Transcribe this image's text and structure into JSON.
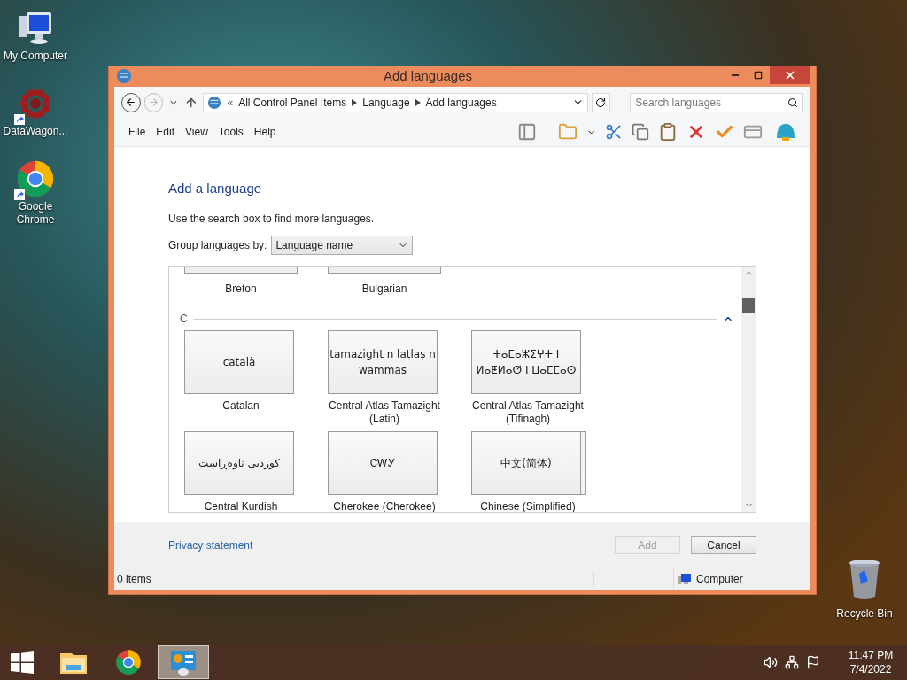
{
  "desktop_icons": [
    {
      "label": "My Computer",
      "kind": "computer",
      "shortcut": false
    },
    {
      "label": "DataWagon...",
      "kind": "flower",
      "shortcut": true
    },
    {
      "label": "Google Chrome",
      "kind": "chrome",
      "shortcut": true
    }
  ],
  "recycle_bin": {
    "label": "Recycle Bin"
  },
  "window": {
    "title": "Add languages",
    "address": {
      "prefix": "«",
      "crumbs": [
        "All Control Panel Items",
        "Language",
        "Add languages"
      ]
    },
    "search": {
      "placeholder": "Search languages"
    },
    "menu": [
      "File",
      "Edit",
      "View",
      "Tools",
      "Help"
    ],
    "heading": "Add a language",
    "hint": "Use the search box to find more languages.",
    "group_by": {
      "label": "Group languages by:",
      "value": "Language name"
    },
    "previous_row": [
      "Breton",
      "Bulgarian"
    ],
    "group": {
      "letter": "C",
      "expanded": true
    },
    "tiles": [
      {
        "native": "català",
        "name": "Catalan",
        "stacked": false
      },
      {
        "native": "tamazight n laṭlaṣ n wammas",
        "name": "Central Atlas Tamazight (Latin)",
        "stacked": false
      },
      {
        "native": "ⵜⴰⵎⴰⵣⵉⵖⵜ ⵏ ⵍⴰⵟⵍⴰⵚ ⵏ ⵡⴰⵎⵎⴰⵙ",
        "name": "Central Atlas Tamazight (Tifinagh)",
        "stacked": false
      },
      {
        "native": "کوردیی ناوەڕاست",
        "name": "Central Kurdish",
        "stacked": false
      },
      {
        "native": "ᏣᎳᎩ",
        "name": "Cherokee (Cherokee)",
        "stacked": false
      },
      {
        "native": "中文(简体)",
        "name": "Chinese (Simplified)",
        "stacked": true
      }
    ],
    "privacy_link": "Privacy statement",
    "buttons": [
      {
        "label": "Add",
        "disabled": true
      },
      {
        "label": "Cancel",
        "disabled": false
      }
    ],
    "status_bar": {
      "items": "0 items",
      "location": "Computer"
    }
  },
  "taskbar": {
    "apps": [
      {
        "kind": "explorer",
        "selected": false
      },
      {
        "kind": "chrome",
        "selected": false
      },
      {
        "kind": "control-panel",
        "selected": true
      }
    ],
    "time": "11:47 PM",
    "date": "7/4/2022"
  }
}
